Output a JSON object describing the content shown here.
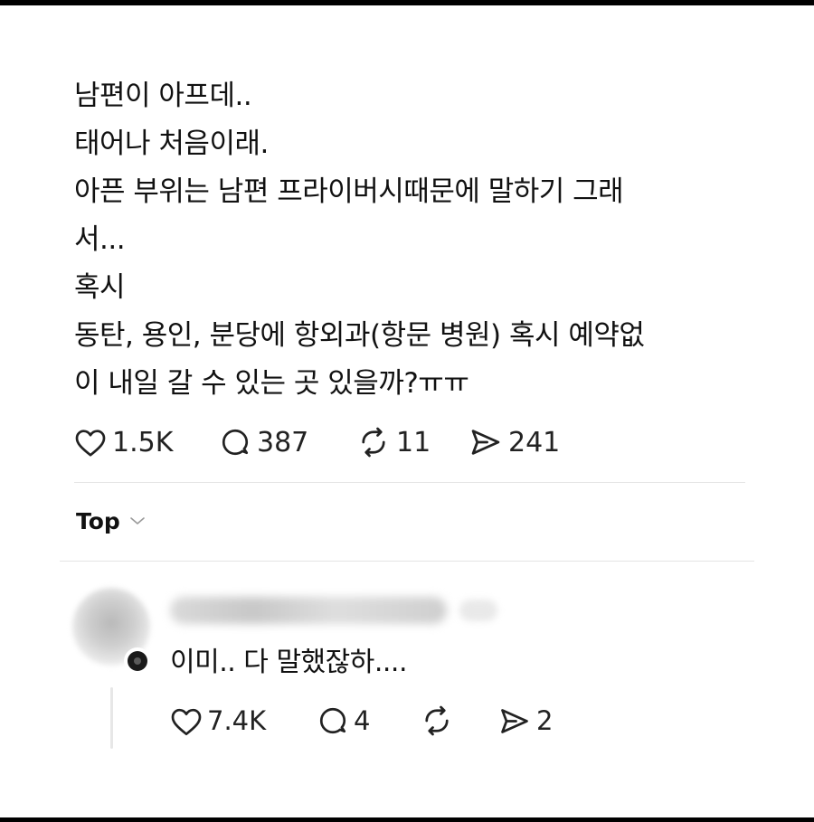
{
  "post": {
    "lines": [
      "남편이 아프데..",
      "태어나 처음이래.",
      "아픈 부위는 남편 프라이버시때문에 말하기 그래",
      "서...",
      "혹시",
      "동탄, 용인, 분당에 항외과(항문 병원) 혹시 예약없",
      "이 내일 갈 수 있는 곳 있을까?ㅠㅠ"
    ],
    "actions": {
      "likes": "1.5K",
      "comments": "387",
      "reposts": "11",
      "shares": "241"
    },
    "icons": {
      "like": "heart-icon",
      "comment": "comment-bubble-icon",
      "repost": "repost-icon",
      "share": "send-icon"
    }
  },
  "replies_sort": {
    "label": "Top",
    "icon": "chevron-down-icon"
  },
  "reply": {
    "text": "이미.. 다 말했잖하....",
    "username_blurred": true,
    "actions": {
      "likes": "7.4K",
      "comments": "4",
      "shares": "2"
    }
  },
  "colors": {
    "text": "#111111",
    "divider": "#e4e4e4",
    "frame": "#000000",
    "background": "#ffffff"
  }
}
